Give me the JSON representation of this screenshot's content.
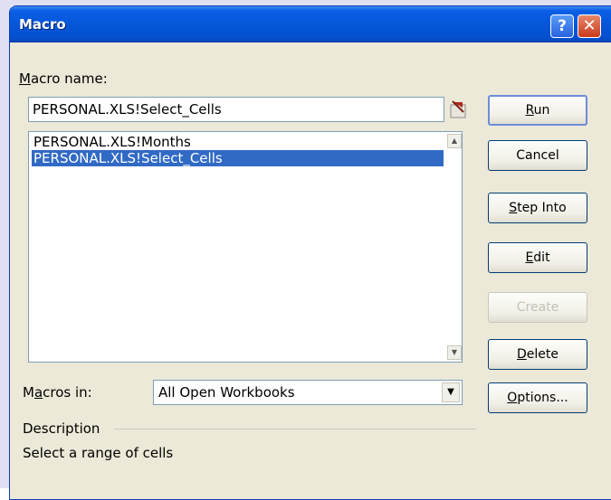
{
  "window": {
    "title": "Macro",
    "help_glyph": "?",
    "close_glyph": "✕"
  },
  "macro_name": {
    "label_first": "M",
    "label_rest": "acro name:",
    "value": "PERSONAL.XLS!Select_Cells"
  },
  "macro_list": {
    "items": [
      {
        "label": "PERSONAL.XLS!Months",
        "selected": false
      },
      {
        "label": "PERSONAL.XLS!Select_Cells",
        "selected": true
      }
    ]
  },
  "buttons": {
    "run": {
      "pre": "",
      "key": "R",
      "post": "un"
    },
    "cancel": {
      "label": "Cancel"
    },
    "step_into": {
      "pre": "",
      "key": "S",
      "post": "tep Into"
    },
    "edit": {
      "pre": "",
      "key": "E",
      "post": "dit"
    },
    "create": {
      "label": "Create"
    },
    "delete": {
      "pre": "",
      "key": "D",
      "post": "elete"
    },
    "options": {
      "pre": "",
      "key": "O",
      "post": "ptions..."
    }
  },
  "macros_in": {
    "label_pre": "M",
    "label_key": "a",
    "label_post": "cros in:",
    "value": "All Open Workbooks"
  },
  "description": {
    "label": "Description",
    "text": "Select a range of cells"
  },
  "colors": {
    "titlebar": "#0556d8",
    "dialog_bg": "#ece9d8",
    "selection": "#316ac5",
    "close_button": "#c83a1b",
    "background_shape": "#dfe0f2"
  }
}
